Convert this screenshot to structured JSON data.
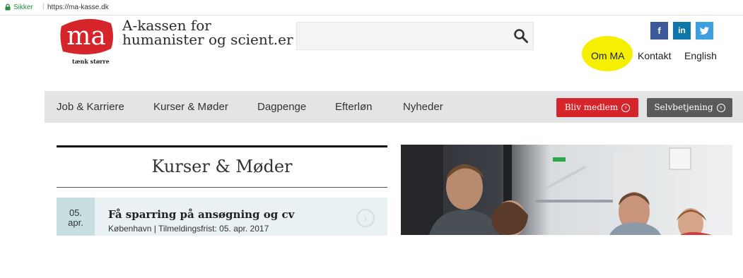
{
  "browser": {
    "secure_label": "Sikker",
    "separator": "|",
    "url": "https://ma-kasse.dk"
  },
  "logo": {
    "mark": "ma",
    "tagline": "tænk større"
  },
  "org": {
    "line1": "A-kassen for",
    "line2": "humanister og scient.er"
  },
  "search": {
    "value": "",
    "placeholder": ""
  },
  "social": {
    "facebook": "f",
    "linkedin": "in",
    "twitter": "t"
  },
  "top_links": {
    "om_ma": "Om MA",
    "kontakt": "Kontakt",
    "english": "English"
  },
  "nav": {
    "items": [
      "Job & Karriere",
      "Kurser & Møder",
      "Dagpenge",
      "Efterløn",
      "Nyheder"
    ],
    "bliv": "Bliv medlem",
    "selv": "Selvbetjening",
    "arrow": "›"
  },
  "kurser": {
    "title": "Kurser & Møder",
    "event": {
      "day": "05.",
      "month": "apr.",
      "title": "Få sparring på ansøgning og cv",
      "meta": "København | Tilmeldingsfrist: 05. apr. 2017",
      "arrow": "›"
    }
  },
  "colors": {
    "brand_red": "#d6242b",
    "highlight": "#f4f000",
    "nav_bg": "#e3e4e6",
    "event_bg": "#e9f1f2",
    "date_bg": "#c8dfe2"
  }
}
